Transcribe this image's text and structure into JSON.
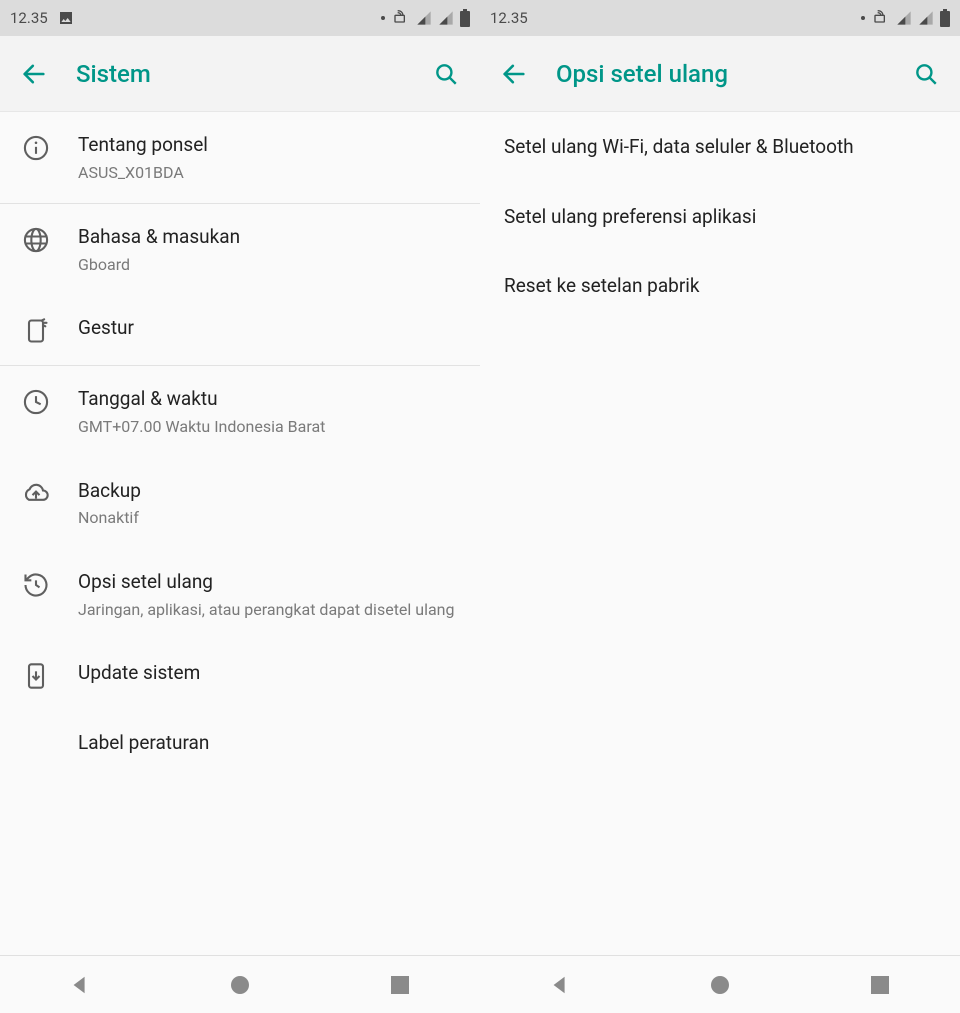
{
  "status": {
    "time": "12.35"
  },
  "left": {
    "title": "Sistem",
    "items": {
      "about": {
        "title": "Tentang ponsel",
        "sub": "ASUS_X01BDA"
      },
      "lang": {
        "title": "Bahasa & masukan",
        "sub": "Gboard"
      },
      "gesture": {
        "title": "Gestur"
      },
      "date": {
        "title": "Tanggal & waktu",
        "sub": "GMT+07.00 Waktu Indonesia Barat"
      },
      "backup": {
        "title": "Backup",
        "sub": "Nonaktif"
      },
      "reset": {
        "title": "Opsi setel ulang",
        "sub": "Jaringan, aplikasi, atau perangkat dapat disetel ulang"
      },
      "update": {
        "title": "Update sistem"
      },
      "label": {
        "title": "Label peraturan"
      }
    }
  },
  "right": {
    "title": "Opsi setel ulang",
    "items": {
      "net": {
        "title": "Setel ulang Wi-Fi, data seluler & Bluetooth"
      },
      "appspref": {
        "title": "Setel ulang preferensi aplikasi"
      },
      "factory": {
        "title": "Reset ke setelan pabrik"
      }
    }
  }
}
